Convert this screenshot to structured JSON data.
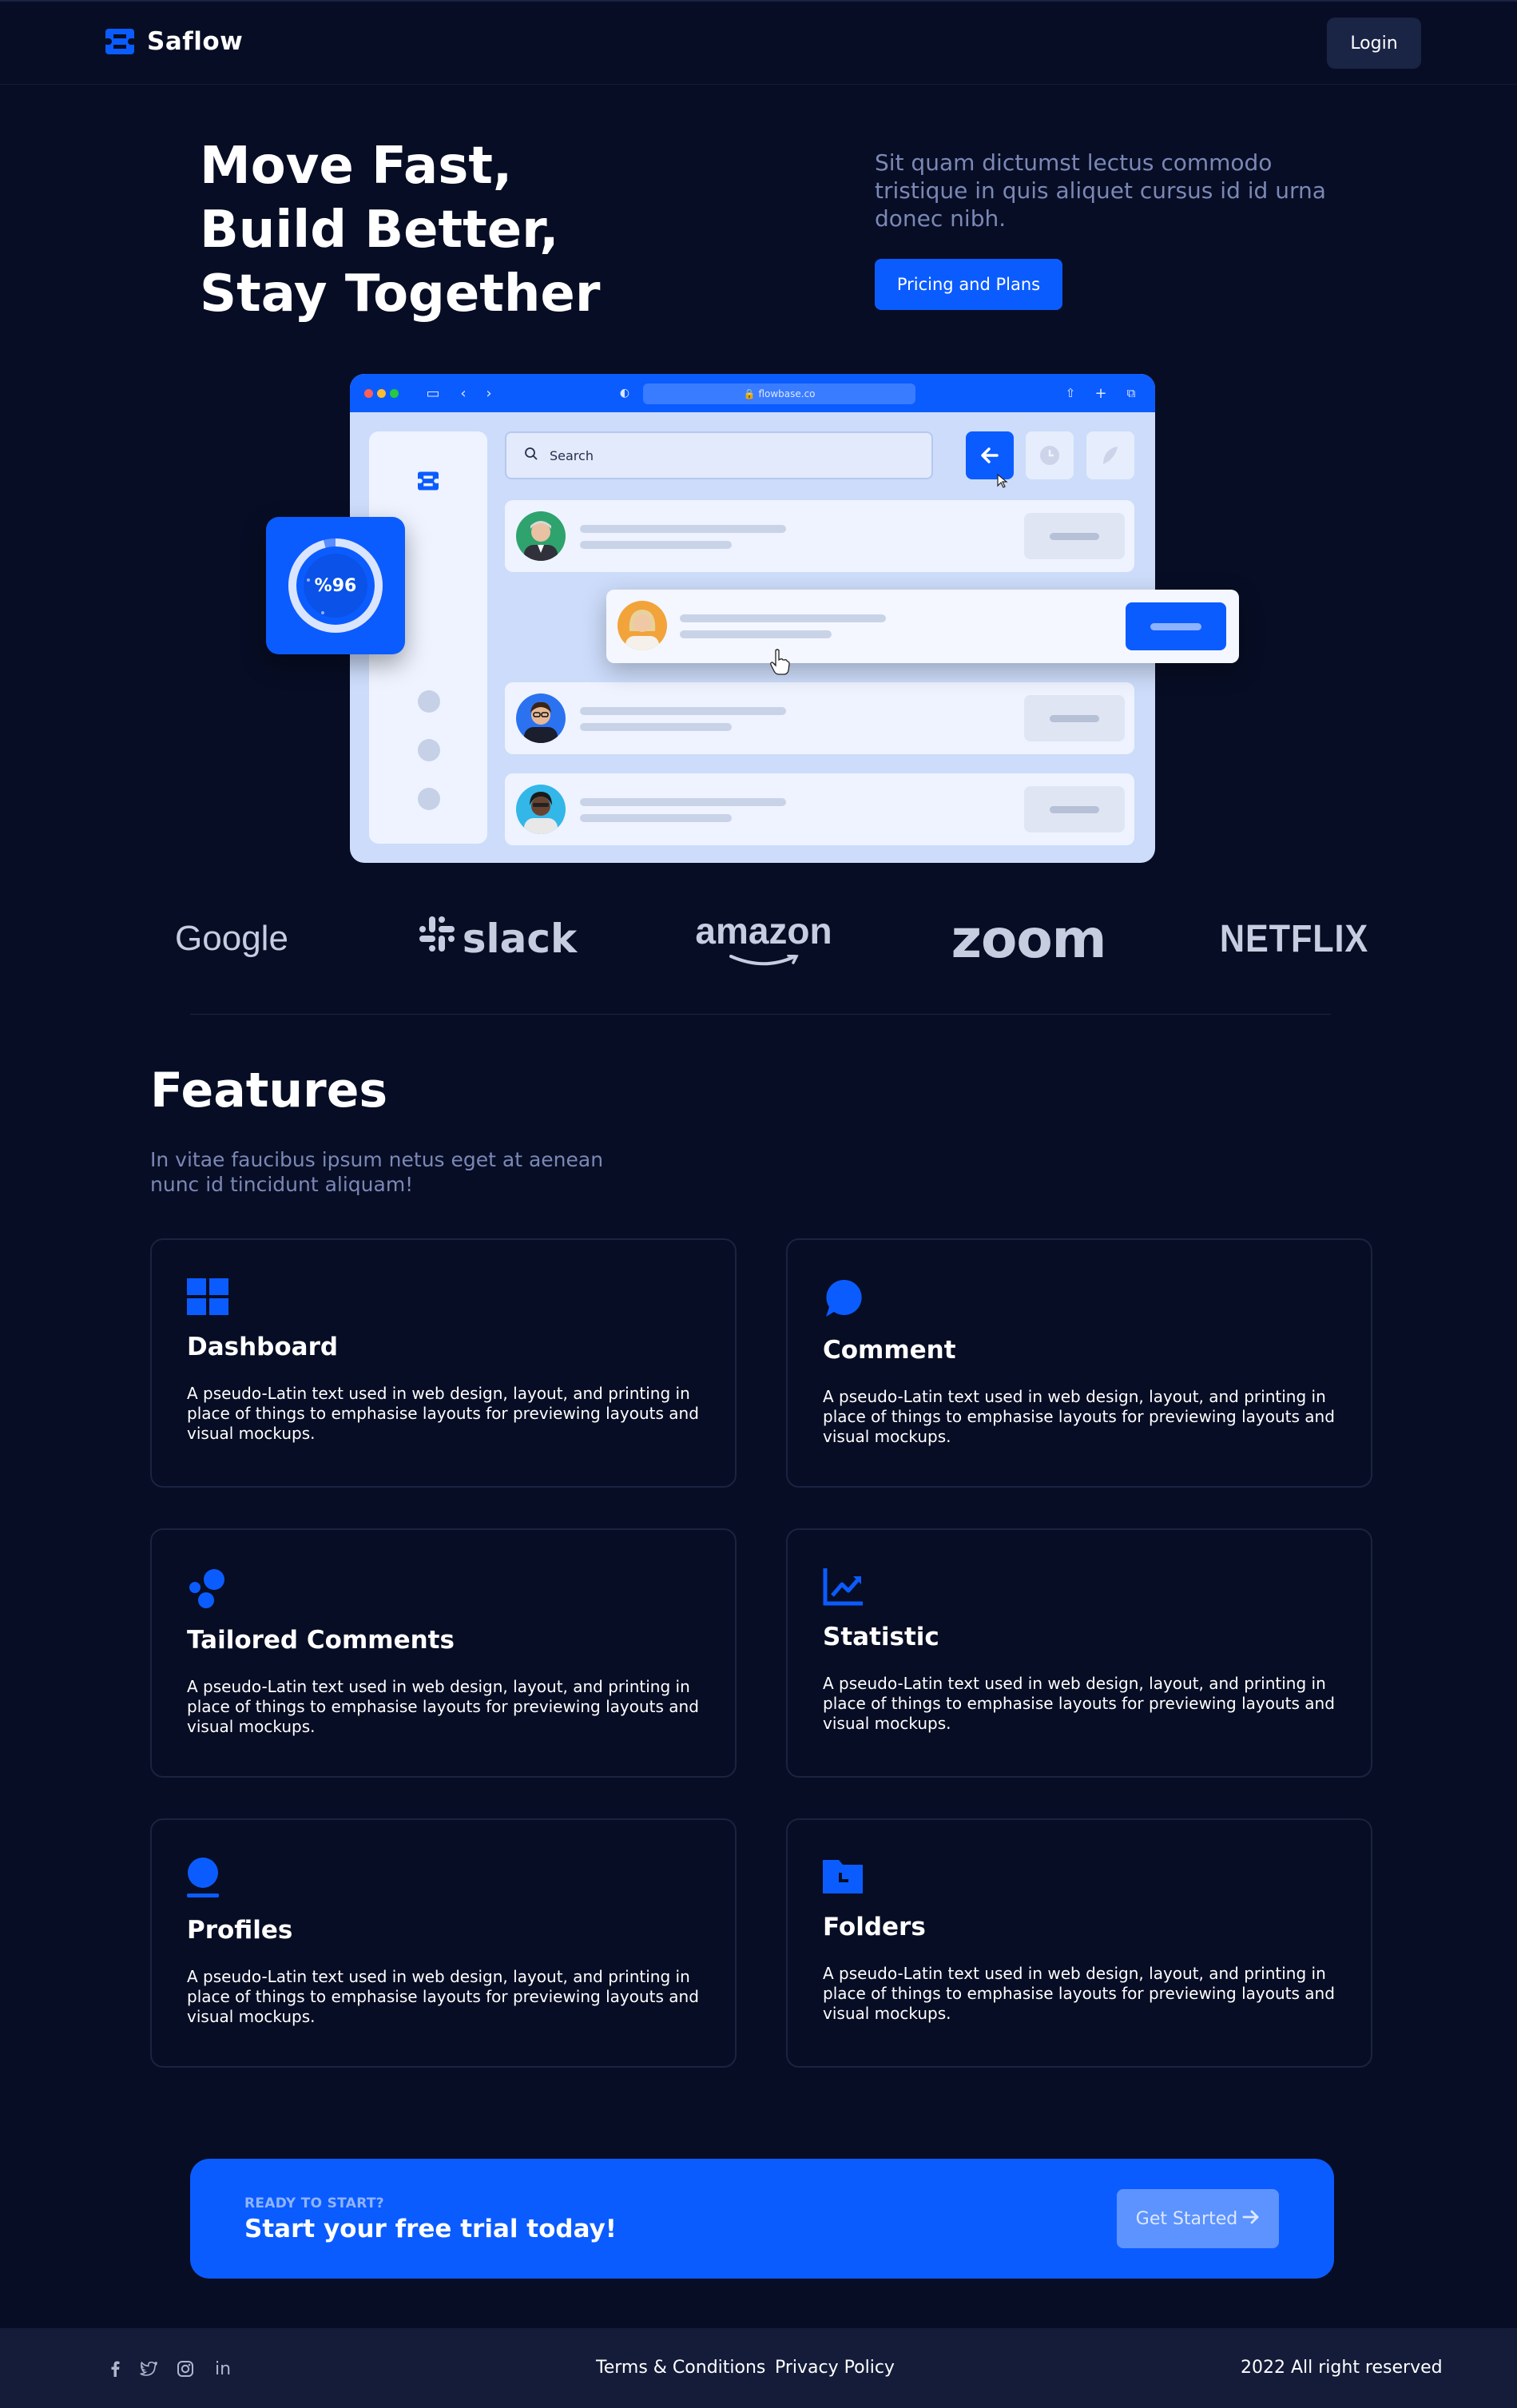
{
  "nav": {
    "brand": "Saflow",
    "login_label": "Login"
  },
  "hero": {
    "title_lines": [
      "Move Fast,",
      "Build Better,",
      "Stay Together"
    ],
    "description": "Sit quam dictumst lectus commodo tristique in quis aliquet cursus id id urna donec nibh.",
    "cta_label": "Pricing and Plans"
  },
  "mockup": {
    "url": "flowbase.co",
    "search_placeholder": "Search",
    "stat_value": "%96"
  },
  "brands": [
    "Google",
    "slack",
    "amazon",
    "zoom",
    "NETFLIX"
  ],
  "features": {
    "title": "Features",
    "subtitle": "In vitae faucibus ipsum netus eget at aenean nunc id tincidunt aliquam!",
    "cards": [
      {
        "icon": "dashboard-icon",
        "title": "Dashboard",
        "text": "A pseudo-Latin text used in web design, layout, and printing in place of things to emphasise layouts for previewing layouts and visual mockups."
      },
      {
        "icon": "comment-icon",
        "title": "Comment",
        "text": "A pseudo-Latin text used in web design, layout, and printing in place of things to emphasise layouts for previewing layouts and visual mockups."
      },
      {
        "icon": "bubbles-icon",
        "title": "Tailored Comments",
        "text": "A pseudo-Latin text used in web design, layout, and printing in place of things to emphasise layouts for previewing layouts and visual mockups."
      },
      {
        "icon": "chart-icon",
        "title": "Statistic",
        "text": "A pseudo-Latin text used in web design, layout, and printing in place of things to emphasise layouts for previewing layouts and visual mockups."
      },
      {
        "icon": "profile-icon",
        "title": "Profiles",
        "text": "A pseudo-Latin text used in web design, layout, and printing in place of things to emphasise layouts for previewing layouts and visual mockups."
      },
      {
        "icon": "folder-icon",
        "title": "Folders",
        "text": "A pseudo-Latin text used in web design, layout, and printing in place of things to emphasise layouts for previewing layouts and visual mockups."
      }
    ]
  },
  "cta": {
    "kicker": "READY TO START?",
    "title": "Start your free trial today!",
    "button_label": "Get Started"
  },
  "footer": {
    "social": [
      "facebook-icon",
      "twitter-icon",
      "instagram-icon",
      "linkedin-icon"
    ],
    "links": [
      "Terms & Conditions",
      "Privacy Policy"
    ],
    "copyright": "2022 All right reserved"
  },
  "colors": {
    "background": "#070d24",
    "accent": "#0b5cff",
    "muted_text": "#7b88b6",
    "card_border": "#1a2340",
    "footer": "#141c3a"
  }
}
